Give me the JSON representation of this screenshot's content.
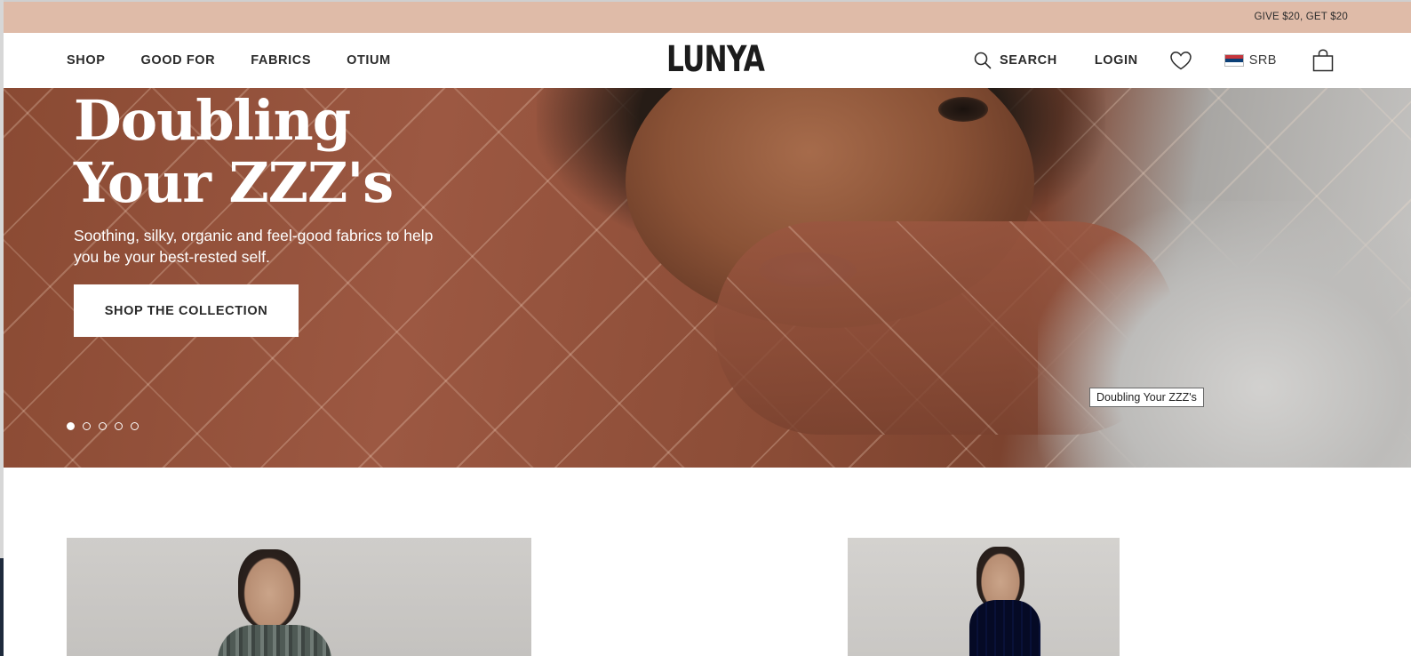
{
  "promo": {
    "text": "GIVE $20, GET $20"
  },
  "nav": {
    "left": [
      "SHOP",
      "GOOD FOR",
      "FABRICS",
      "OTIUM"
    ],
    "logo": "LUNYA",
    "search_label": "SEARCH",
    "login_label": "LOGIN",
    "country_code": "SRB"
  },
  "hero": {
    "title_line1": "Doubling",
    "title_line2": "Your ZZZ's",
    "subtitle": "Soothing, silky, organic and feel-good fabrics to help you be your best-rested self.",
    "cta_label": "SHOP THE COLLECTION",
    "tooltip": "Doubling Your ZZZ's",
    "slides_total": 5,
    "active_slide": 1
  },
  "colors": {
    "promo_bg": "#dfbba8",
    "text_dark": "#2b2b2b",
    "white": "#ffffff"
  },
  "icons": [
    "search-icon",
    "heart-icon",
    "serbia-flag-icon",
    "shopping-bag-icon"
  ]
}
